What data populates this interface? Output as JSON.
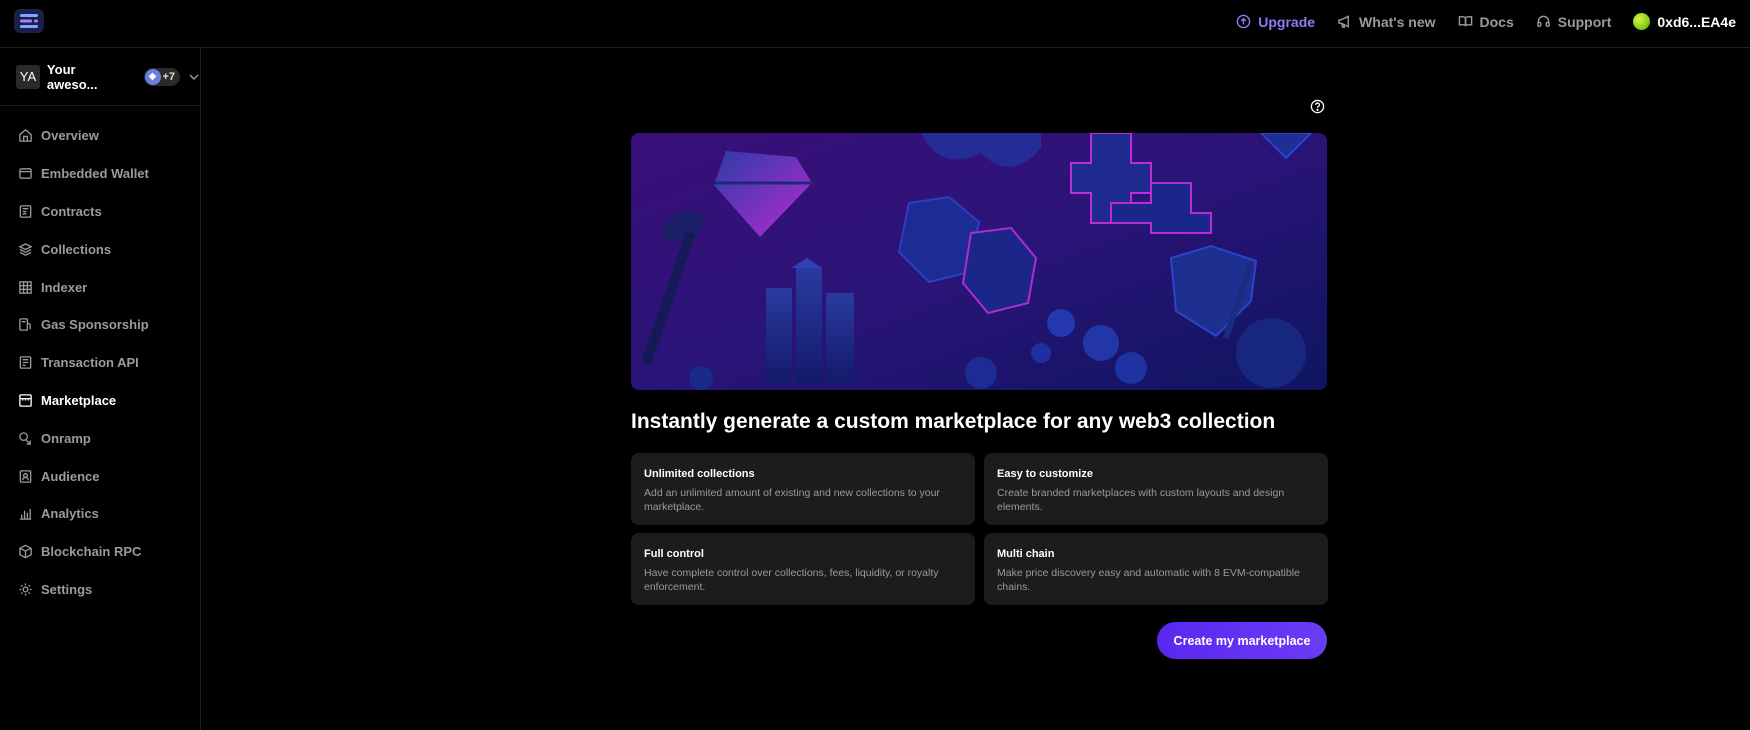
{
  "header": {
    "upgrade_label": "Upgrade",
    "whats_new_label": "What's new",
    "docs_label": "Docs",
    "support_label": "Support",
    "wallet_address": "0xd6...EA4e"
  },
  "team": {
    "initials": "YA",
    "name": "Your aweso...",
    "chain_count": "+7"
  },
  "sidebar": {
    "items": [
      {
        "label": "Overview",
        "icon": "home-icon"
      },
      {
        "label": "Embedded Wallet",
        "icon": "wallet-icon"
      },
      {
        "label": "Contracts",
        "icon": "contract-icon"
      },
      {
        "label": "Collections",
        "icon": "layers-icon"
      },
      {
        "label": "Indexer",
        "icon": "grid-icon"
      },
      {
        "label": "Gas Sponsorship",
        "icon": "gas-pump-icon"
      },
      {
        "label": "Transaction API",
        "icon": "document-icon"
      },
      {
        "label": "Marketplace",
        "icon": "store-icon",
        "active": true
      },
      {
        "label": "Onramp",
        "icon": "onramp-icon"
      },
      {
        "label": "Audience",
        "icon": "contact-icon"
      },
      {
        "label": "Analytics",
        "icon": "bar-chart-icon"
      },
      {
        "label": "Blockchain RPC",
        "icon": "cube-icon"
      },
      {
        "label": "Settings",
        "icon": "gear-icon"
      }
    ]
  },
  "main": {
    "headline": "Instantly generate a custom marketplace for any web3 collection",
    "features": [
      {
        "title": "Unlimited collections",
        "description": "Add an unlimited amount of existing and new collections to your marketplace."
      },
      {
        "title": "Easy to customize",
        "description": "Create branded marketplaces with custom layouts and design elements."
      },
      {
        "title": "Full control",
        "description": "Have complete control over collections, fees, liquidity, or royalty enforcement."
      },
      {
        "title": "Multi chain",
        "description": "Make price discovery easy and automatic with 8 EVM-compatible chains."
      }
    ],
    "cta_label": "Create my marketplace"
  },
  "colors": {
    "accent": "#8b7cf6",
    "cta": "#5a27f0",
    "card_bg": "#1c1c1c",
    "muted_text": "#9a9aa0"
  }
}
